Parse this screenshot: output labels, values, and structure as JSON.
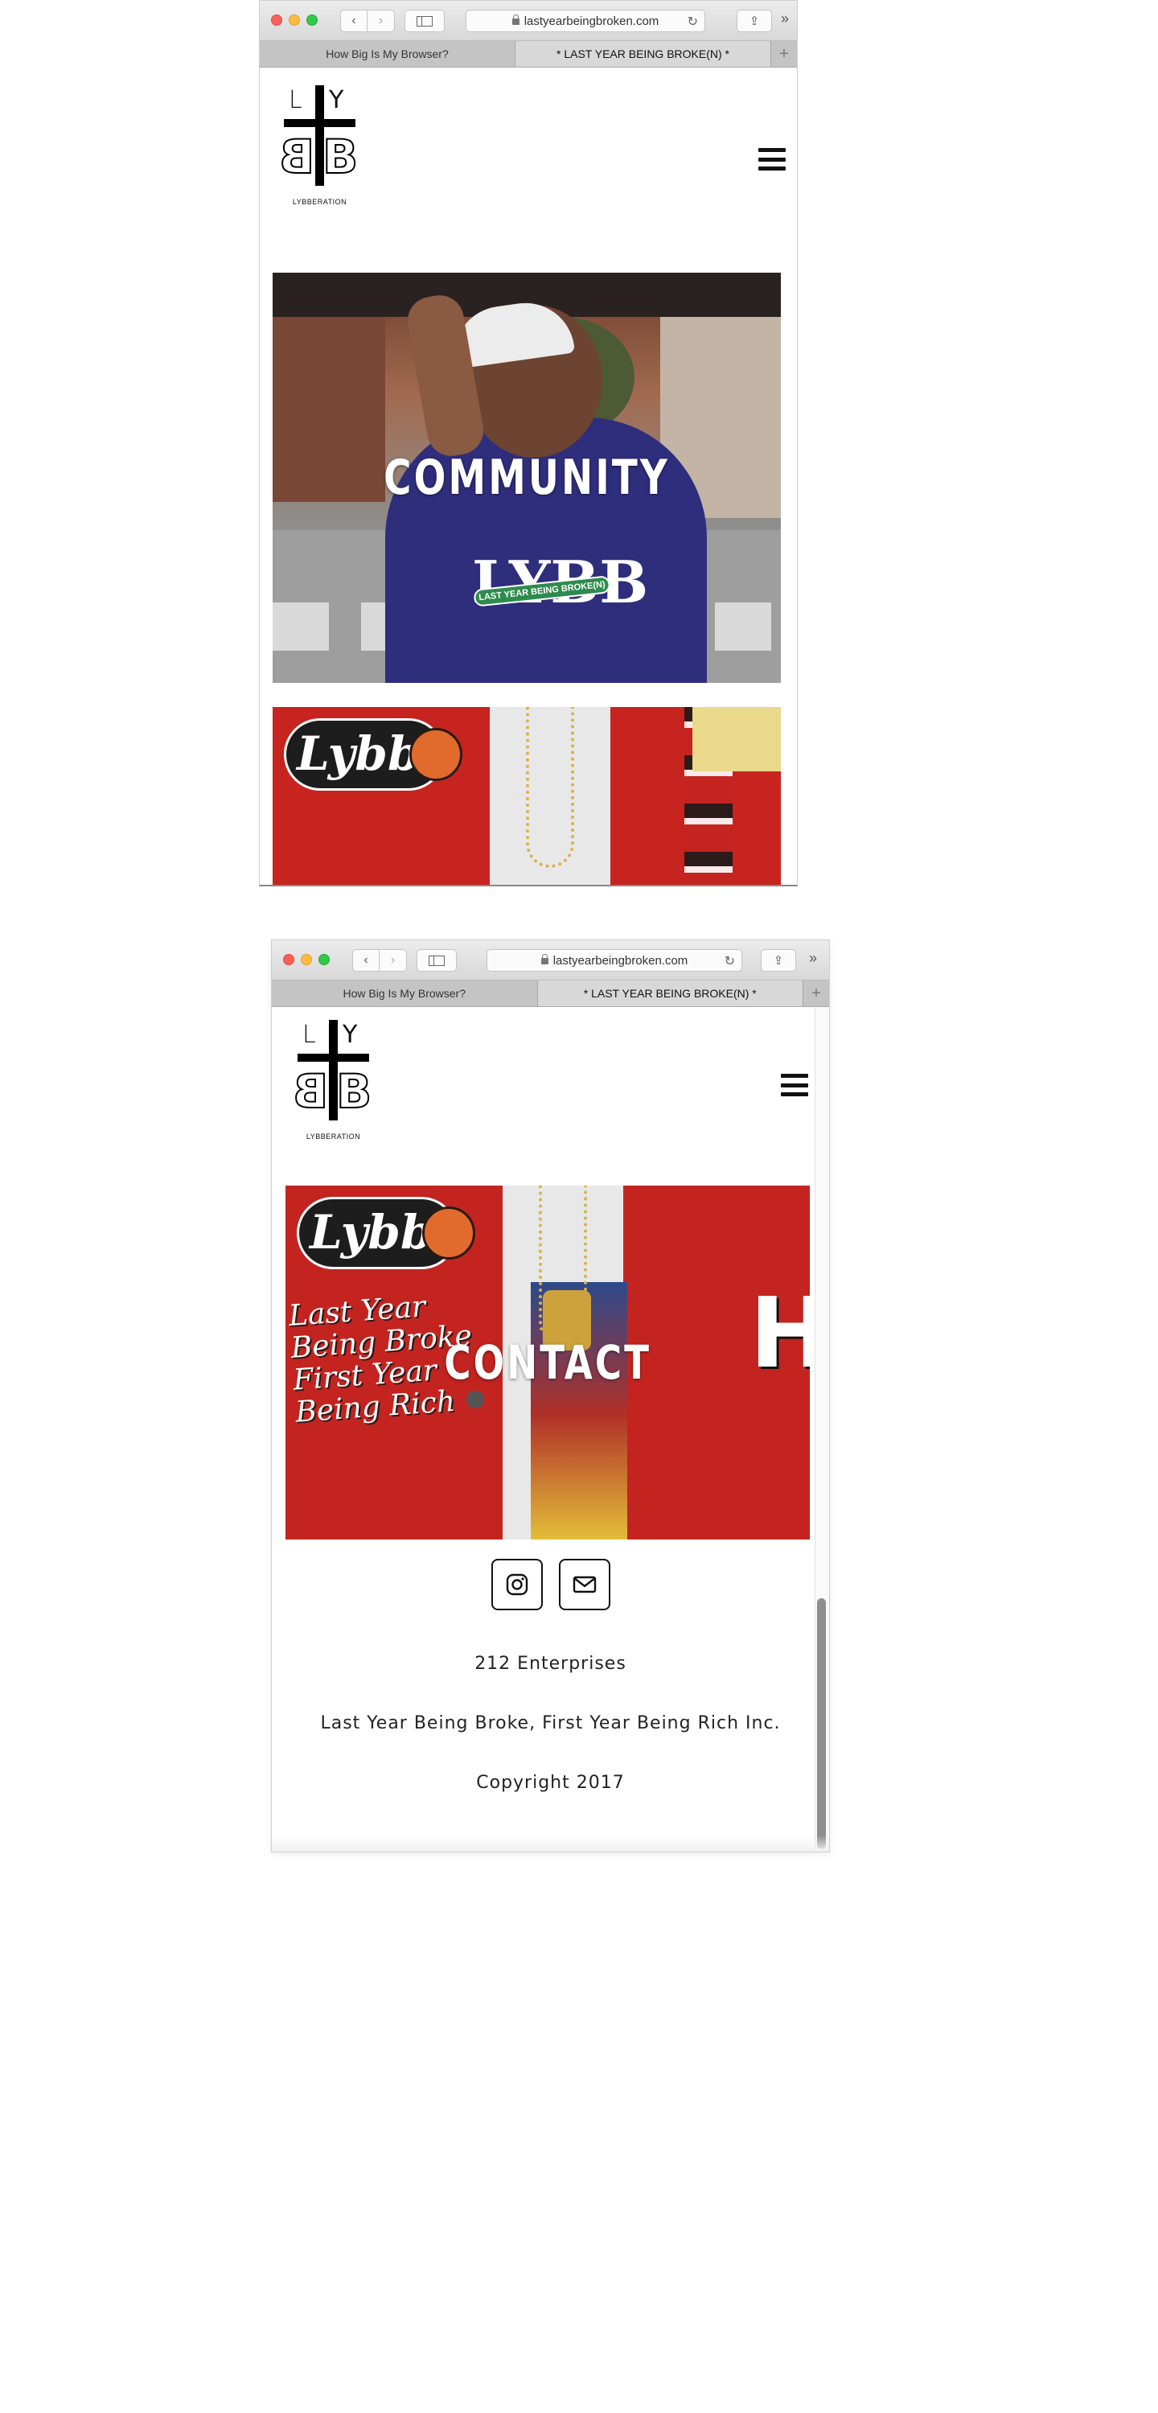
{
  "browser": {
    "url": "lastyearbeingbroken.com",
    "tabs": [
      {
        "label": "How Big Is My Browser?",
        "active": false
      },
      {
        "label": "* LAST YEAR BEING BROKE(N) *",
        "active": true
      }
    ],
    "new_tab_symbol": "+",
    "back_symbol": "‹",
    "forward_symbol": "›",
    "reload_symbol": "↻",
    "share_symbol": "⇪",
    "more_symbol": "»"
  },
  "site": {
    "logo": {
      "letter_l": "L",
      "letter_y": "Y",
      "letter_b": "B",
      "caption": "LYBBERATION"
    },
    "tiles": {
      "community": "COMMUNITY",
      "contact": "CONTACT"
    },
    "image_text": {
      "hoodie_logo": "LYBB",
      "hoodie_band": "LAST YEAR BEING BROKE(N)",
      "patch": "Lybb",
      "script_line1": "Last Year",
      "script_line2": "Being Broke",
      "script_line3": "First Year",
      "script_line4": "Being Rich",
      "jacket_letter": "H"
    },
    "footer": {
      "line1": "212 Enterprises",
      "line2": "Last Year Being Broke, First Year Being Rich Inc.",
      "line3": "Copyright 2017"
    },
    "social": [
      {
        "icon": "instagram-icon"
      },
      {
        "icon": "email-icon"
      }
    ]
  },
  "colors": {
    "accent_red": "#c32420",
    "hoodie_navy": "#2f2e7c",
    "text_dark": "#111111"
  }
}
